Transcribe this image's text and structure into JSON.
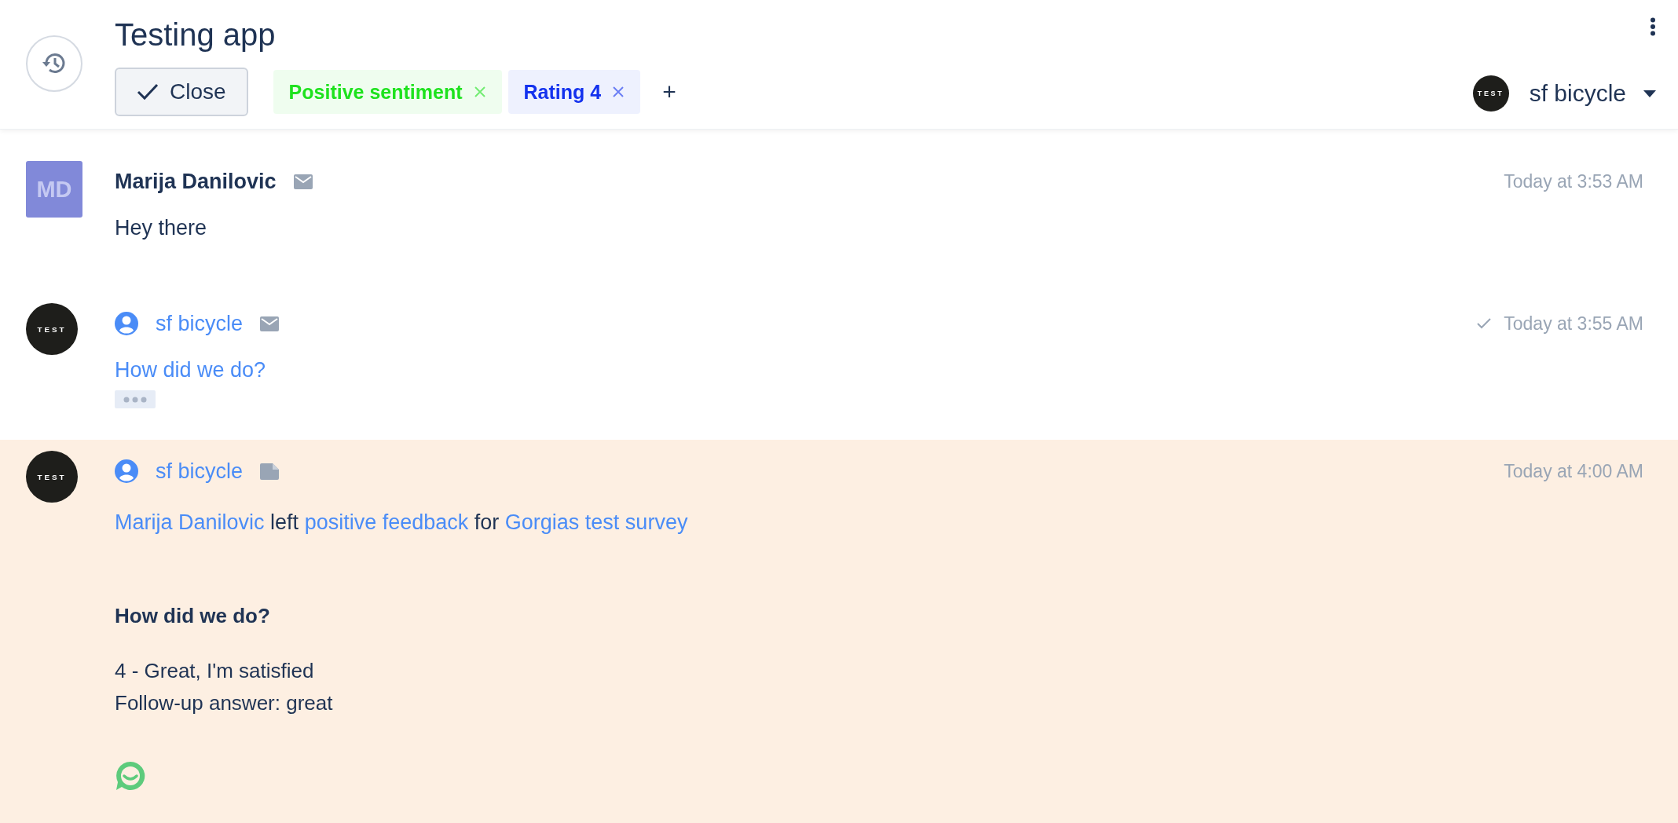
{
  "header": {
    "title": "Testing app",
    "close_button": "Close",
    "tags": [
      {
        "label": "Positive sentiment",
        "color": "#1ee21e"
      },
      {
        "label": "Rating 4",
        "color": "#1432ee"
      }
    ],
    "add_tag": "+",
    "account": {
      "avatar": "TEST",
      "name": "sf bicycle"
    }
  },
  "messages": [
    {
      "kind": "customer",
      "avatar": "MD",
      "author": "Marija Danilovic",
      "time": "Today at 3:53 AM",
      "delivered": false,
      "body": "Hey there"
    },
    {
      "kind": "agent",
      "avatar": "TEST",
      "author": "sf bicycle",
      "time": "Today at 3:55 AM",
      "delivered": true,
      "body": "How did we do?"
    },
    {
      "kind": "survey",
      "avatar": "TEST",
      "author": "sf bicycle",
      "time": "Today at 4:00 AM",
      "delivered": false,
      "sentence": [
        {
          "text": "Marija Danilovic",
          "link": true
        },
        {
          "text": "left",
          "link": false
        },
        {
          "text": "positive feedback",
          "link": true
        },
        {
          "text": "for",
          "link": false
        },
        {
          "text": "Gorgias test survey",
          "link": true
        }
      ],
      "question": "How did we do?",
      "answers": [
        "4 - Great, I'm satisfied",
        "Follow-up answer: great"
      ]
    }
  ]
}
